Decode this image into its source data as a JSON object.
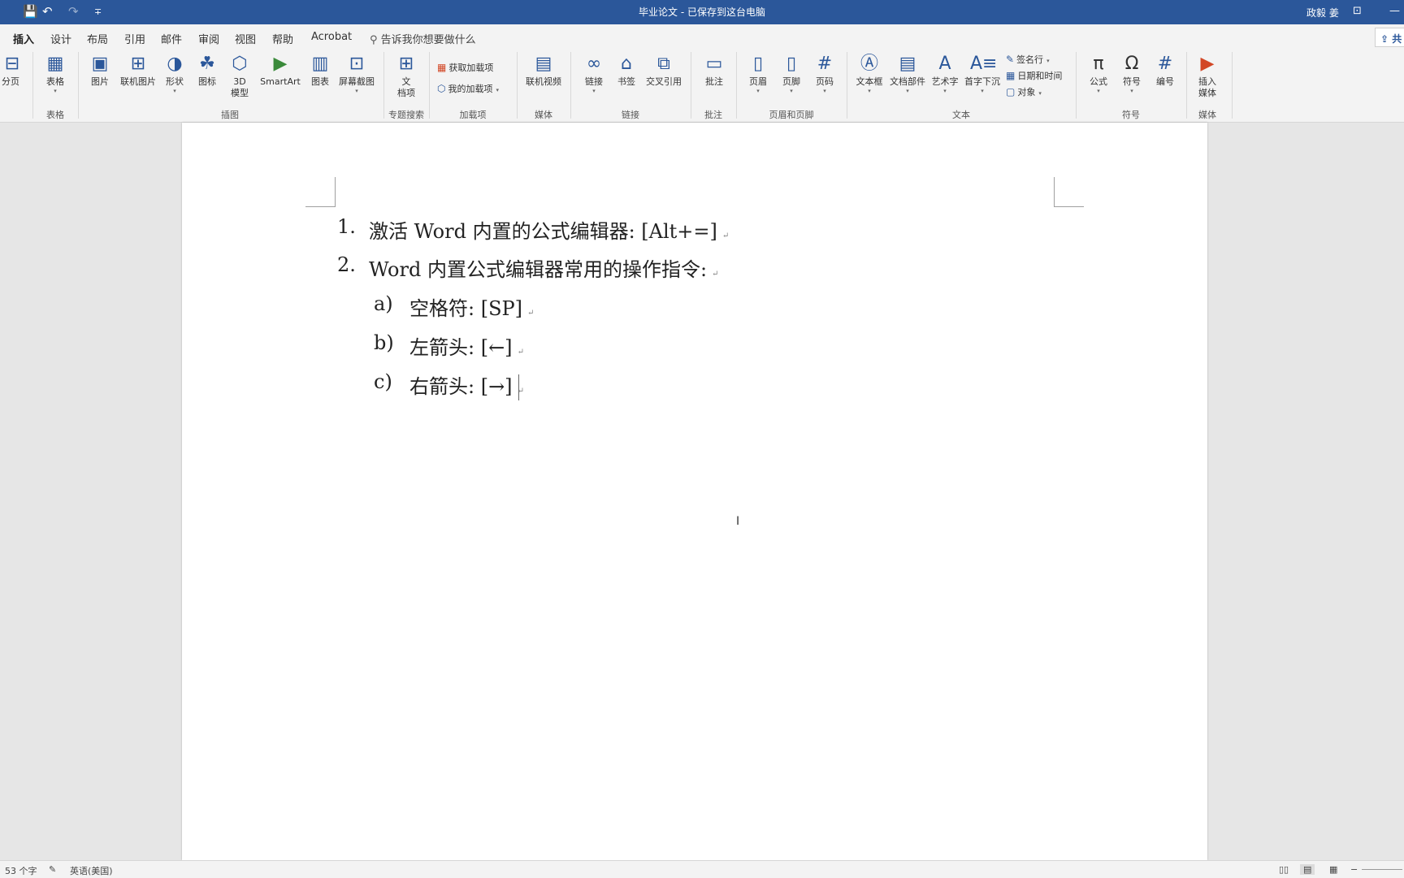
{
  "titlebar": {
    "title": "毕业论文 - 已保存到这台电脑",
    "user": "政毅 姜",
    "save_icon": "💾",
    "undo_icon": "↶",
    "redo_icon": "↷",
    "qa_more": "∓",
    "ribbon_display_icon": "⊡",
    "minimize_icon": "—"
  },
  "tabs": [
    "插入",
    "设计",
    "布局",
    "引用",
    "邮件",
    "审阅",
    "视图",
    "帮助",
    "Acrobat"
  ],
  "tell_me": "告诉我你想要做什么",
  "share": "共",
  "ribbon": {
    "buttons": {
      "page_break": "分页",
      "table": "表格",
      "picture": "图片",
      "online_picture": "联机图片",
      "shapes": "形状",
      "icons": "图标",
      "model3d": "3D\n模型",
      "smartart": "SmartArt",
      "chart": "图表",
      "screenshot": "屏幕截图",
      "document_item": "文\n档项",
      "get_addins": "获取加载项",
      "my_addins": "我的加载项",
      "online_video": "联机视频",
      "link": "链接",
      "bookmark": "书签",
      "cross_reference": "交叉引用",
      "comment": "批注",
      "header": "页眉",
      "footer": "页脚",
      "page_number": "页码",
      "text_box": "文本框",
      "quick_parts": "文档部件",
      "wordart": "艺术字",
      "drop_cap": "首字下沉",
      "signature_line": "签名行",
      "date_time": "日期和时间",
      "object": "对象",
      "equation": "公式",
      "symbol": "符号",
      "number": "编号",
      "insert_media": "插入\n媒体"
    },
    "groups": {
      "tables": "表格",
      "illustrations": "插图",
      "topic_search": "专题搜索",
      "addins": "加载项",
      "media": "媒体",
      "links": "链接",
      "comments": "批注",
      "header_footer": "页眉和页脚",
      "text": "文本",
      "symbols": "符号",
      "media2": "媒体"
    }
  },
  "document": {
    "lines": [
      {
        "num": "1.",
        "text": "激活 Word 内置的公式编辑器: [Alt+=]"
      },
      {
        "num": "2.",
        "text": "Word 内置公式编辑器常用的操作指令:"
      },
      {
        "num": "a)",
        "text": "空格符: [SP]"
      },
      {
        "num": "b)",
        "text": "左箭头: [←]"
      },
      {
        "num": "c)",
        "text": "右箭头: [→]"
      }
    ],
    "paragraph_mark": "↵"
  },
  "statusbar": {
    "word_count": "53 个字",
    "proof_icon": "✎",
    "language": "英语(美国)",
    "zoom_out": "−"
  }
}
